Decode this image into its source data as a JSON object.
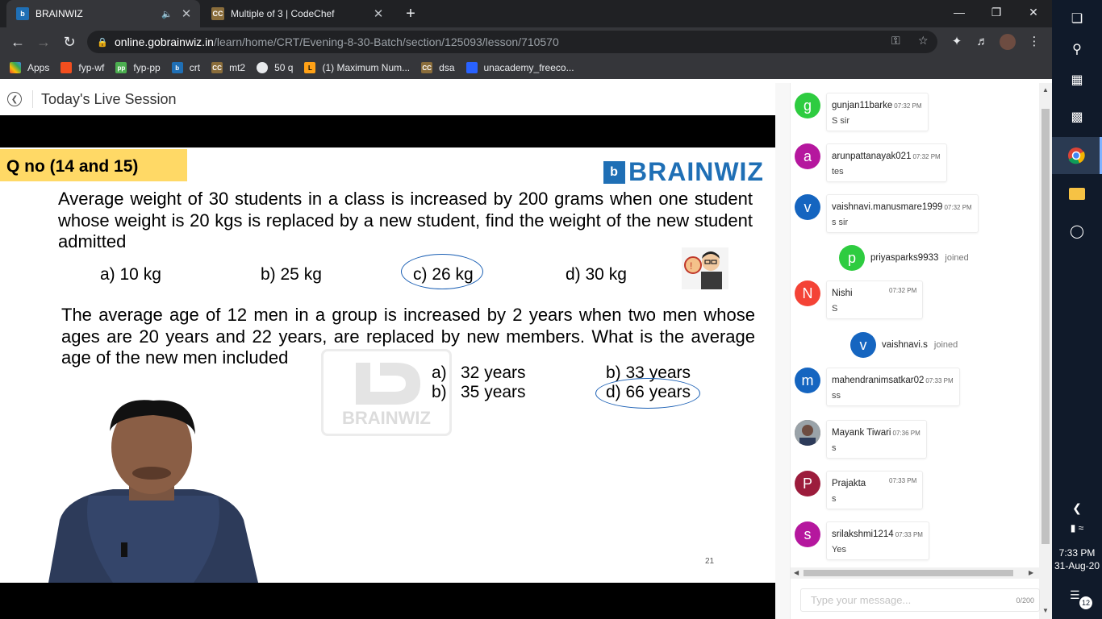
{
  "browser": {
    "tabs": [
      {
        "title": "BRAINWIZ",
        "favicon": "brainwiz-favicon"
      },
      {
        "title": "Multiple of 3 | CodeChef",
        "favicon": "codechef-favicon"
      }
    ],
    "url_host": "online.gobrainwiz.in",
    "url_path": "/learn/home/CRT/Evening-8-30-Batch/section/125093/lesson/710570",
    "bookmarks": [
      {
        "label": "Apps",
        "icon": "apps-grid-icon",
        "color": "#ea4335"
      },
      {
        "label": "fyp-wf",
        "icon": "figma-icon",
        "color": "#f24e1e"
      },
      {
        "label": "fyp-pp",
        "icon": "pp-icon",
        "color": "#4caf50"
      },
      {
        "label": "crt",
        "icon": "brainwiz-icon",
        "color": "#1f6fb5"
      },
      {
        "label": "mt2",
        "icon": "codechef-icon",
        "color": "#8a6d3b"
      },
      {
        "label": "50 q",
        "icon": "globe-icon",
        "color": "#e8eaed"
      },
      {
        "label": "(1) Maximum Num...",
        "icon": "leetcode-icon",
        "color": "#ffa116"
      },
      {
        "label": "dsa",
        "icon": "codechef-icon",
        "color": "#8a6d3b"
      },
      {
        "label": "unacademy_freeco...",
        "icon": "unacademy-icon",
        "color": "#2962ff"
      }
    ]
  },
  "page": {
    "title": "Today's Live Session"
  },
  "slide": {
    "question_tag": "Q no (14 and 15)",
    "brand": "BRAINWIZ",
    "q1": "Average weight of 30 students in a class is increased by 200 grams when one student whose weight is 20 kgs is replaced by a new student, find the weight of the new student admitted",
    "q1_options": [
      "a) 10 kg",
      "b) 25 kg",
      "c) 26 kg",
      "d) 30 kg"
    ],
    "q2": "The average age of 12 men in a group is increased by 2 years when two men whose ages are 20 years and 22 years, are replaced by new members. What is the average age of the new men included",
    "q2_options": [
      {
        "letter": "a)",
        "text": "32 years"
      },
      {
        "letter": "b) 33 years",
        "text": ""
      },
      {
        "letter": "b)",
        "text": "35 years"
      },
      {
        "letter": "d) 66 years",
        "text": ""
      }
    ],
    "watermark": "BRAINWIZ",
    "page_number": "21"
  },
  "chat": {
    "messages": [
      {
        "kind": "msg",
        "initial": "g",
        "color": "#2ecc40",
        "name": "gunjan11barke",
        "time": "07:32 PM",
        "text": "S sir"
      },
      {
        "kind": "msg",
        "initial": "a",
        "color": "#b5179e",
        "name": "arunpattanayak021",
        "time": "07:32 PM",
        "text": "tes"
      },
      {
        "kind": "msg",
        "initial": "v",
        "color": "#1565c0",
        "name": "vaishnavi.manusmare1999",
        "time": "07:32 PM",
        "text": "s sir"
      },
      {
        "kind": "joined",
        "initial": "p",
        "color": "#2ecc40",
        "name": "priyasparks9933",
        "word": "joined"
      },
      {
        "kind": "msg",
        "initial": "N",
        "color": "#f44336",
        "name": "Nishi",
        "time": "07:32 PM",
        "text": "S"
      },
      {
        "kind": "joined",
        "initial": "v",
        "color": "#1565c0",
        "name": "vaishnavi.s",
        "word": "joined"
      },
      {
        "kind": "msg",
        "initial": "m",
        "color": "#1565c0",
        "name": "mahendranimsatkar02",
        "time": "07:33 PM",
        "text": "ss"
      },
      {
        "kind": "msg",
        "initial": "",
        "color": "#6d4c41",
        "name": "Mayank Tiwari",
        "time": "07:36 PM",
        "text": "s"
      },
      {
        "kind": "msg",
        "initial": "P",
        "color": "#9c1c3c",
        "name": "Prajakta",
        "time": "07:33 PM",
        "text": "s"
      },
      {
        "kind": "msg",
        "initial": "s",
        "color": "#b5179e",
        "name": "srilakshmi1214",
        "time": "07:33 PM",
        "text": "Yes"
      }
    ],
    "input_placeholder": "Type your message...",
    "char_count": "0/200"
  },
  "taskbar": {
    "time": "7:33 PM",
    "date": "31-Aug-20",
    "notifications": "12"
  }
}
